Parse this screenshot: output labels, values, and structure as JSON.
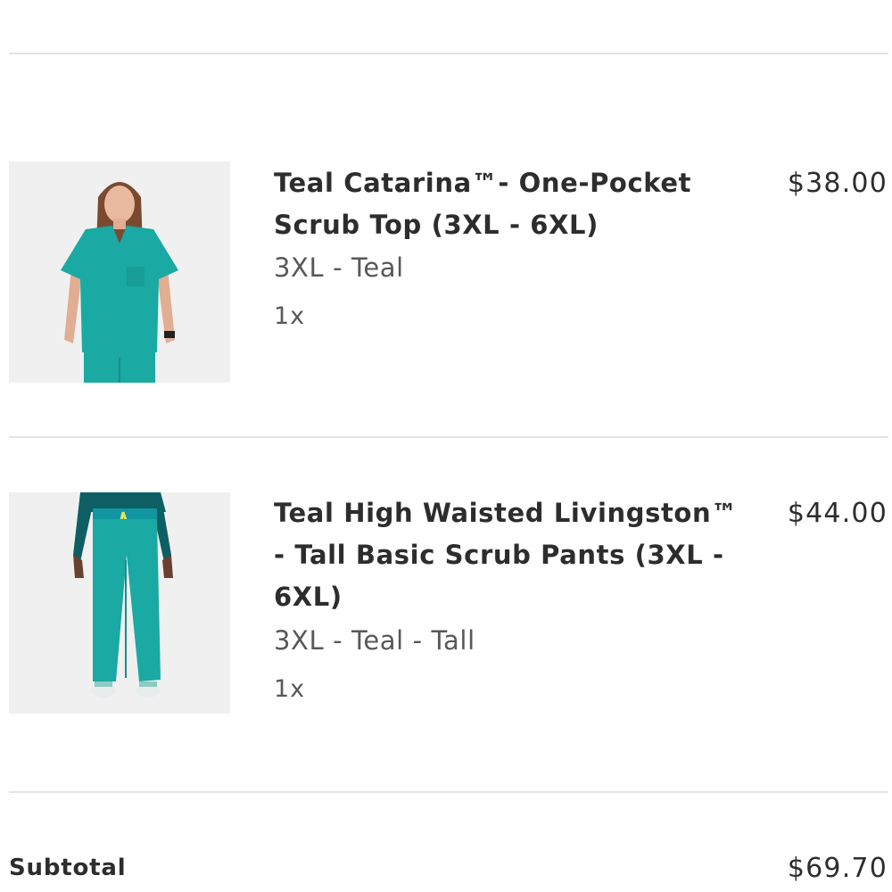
{
  "cart": {
    "items": [
      {
        "title": "Teal Catarina™- One-Pocket Scrub Top (3XL - 6XL)",
        "price": "$38.00",
        "variant": "3XL - Teal",
        "quantity": "1x",
        "image_icon": "scrub-top-product-image"
      },
      {
        "title": "Teal High Waisted Livingston™ - Tall Basic Scrub Pants (3XL - 6XL)",
        "price": "$44.00",
        "variant": "3XL - Teal - Tall",
        "quantity": "1x",
        "image_icon": "scrub-pants-product-image"
      }
    ],
    "subtotal_label": "Subtotal",
    "subtotal_value": "$69.70"
  },
  "colors": {
    "product_teal": "#1aa9a3",
    "divider": "#e4e4e4",
    "text_dark": "#2d2d2d",
    "text_muted": "#585858"
  }
}
